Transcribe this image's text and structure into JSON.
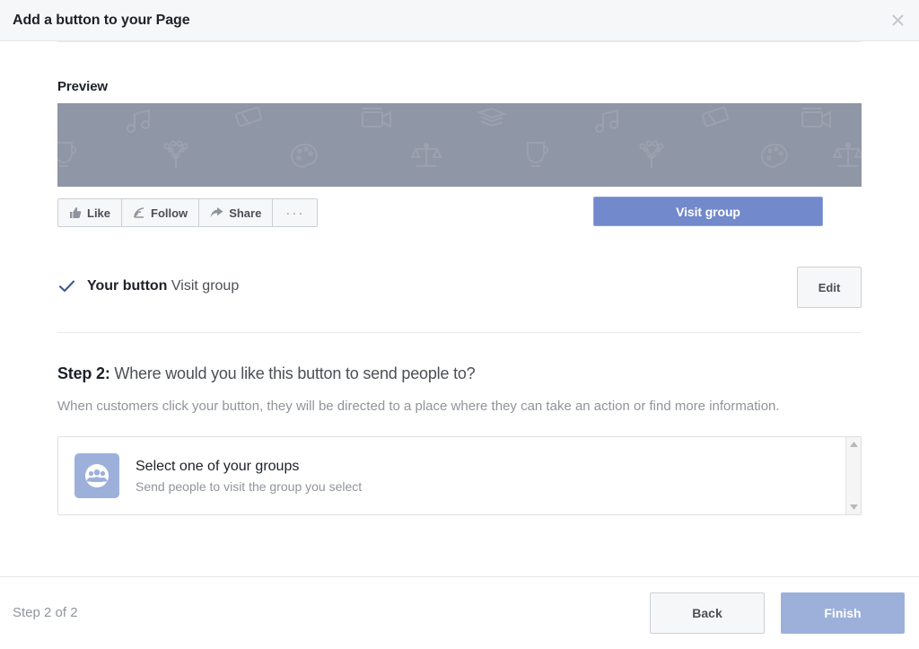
{
  "header": {
    "title": "Add a button to your Page",
    "close_icon": "close-icon"
  },
  "preview": {
    "label": "Preview",
    "cover_color": "#8f96a5",
    "page_actions": [
      {
        "label": "Like",
        "icon": "thumbs-up-icon"
      },
      {
        "label": "Follow",
        "icon": "rss-icon"
      },
      {
        "label": "Share",
        "icon": "share-arrow-icon"
      },
      {
        "label": "···",
        "icon": "ellipsis-icon"
      }
    ],
    "cta": {
      "label": "Visit group",
      "color": "#7289cb",
      "border_color": "#8fa2d9",
      "text_color": "#ffffff"
    }
  },
  "your_button": {
    "check_icon": "check-icon",
    "check_color": "#3b5998",
    "label": "Your button",
    "value": "Visit group",
    "edit_label": "Edit"
  },
  "step2": {
    "heading_strong": "Step 2:",
    "heading_rest": " Where would you like this button to send people to?",
    "description": "When customers click your button, they will be directed to a place where they can take an action or find more information.",
    "options": [
      {
        "icon": "group-people-icon",
        "icon_color": "#9cb0da",
        "title": "Select one of your groups",
        "subtitle": "Send people to visit the group you select"
      }
    ],
    "scrollbar": {
      "up_icon": "scroll-up-arrow-icon",
      "down_icon": "scroll-down-arrow-icon"
    }
  },
  "footer": {
    "step_count": "Step 2 of 2",
    "back_label": "Back",
    "finish_label": "Finish",
    "finish_color": "#9cb0da"
  }
}
